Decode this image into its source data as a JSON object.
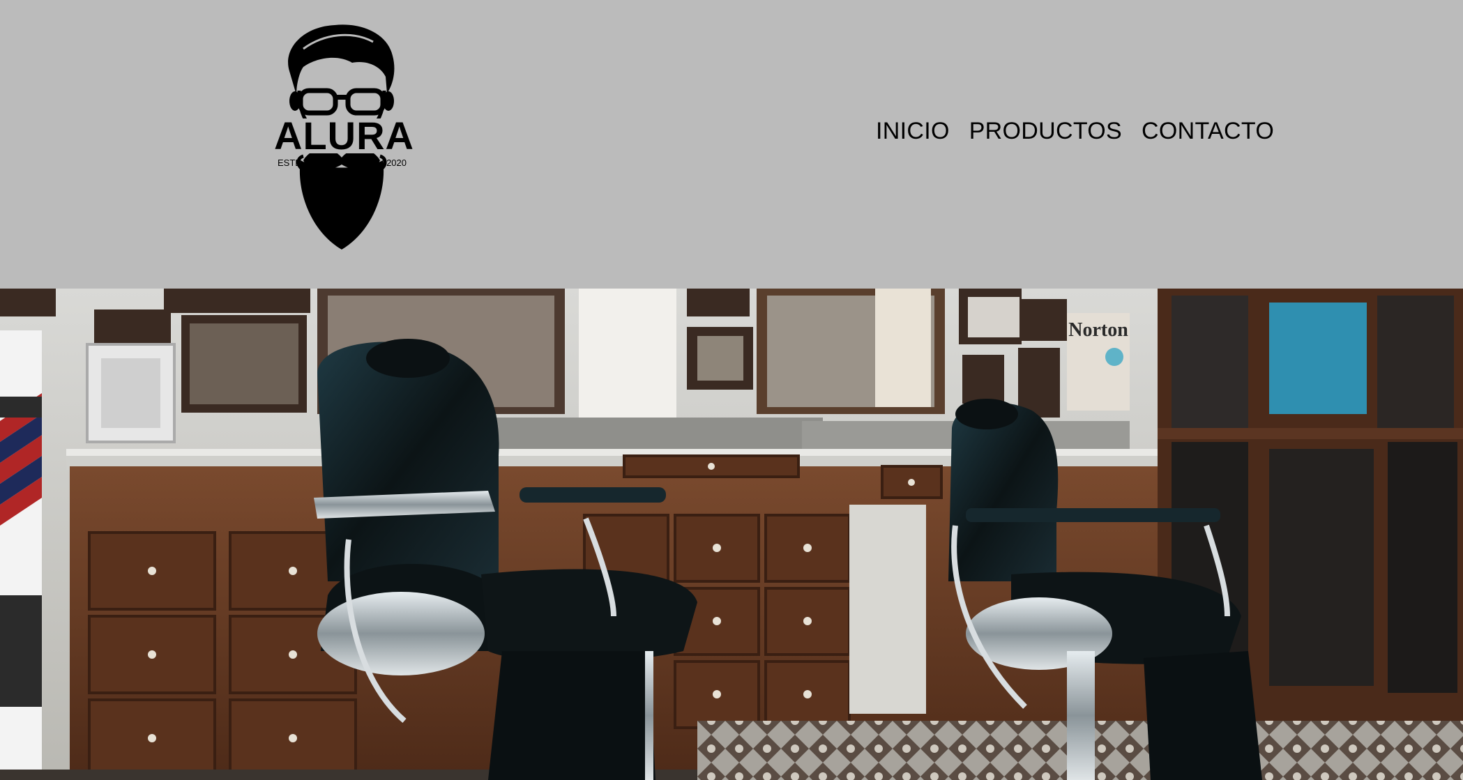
{
  "brand": {
    "name": "ALURA",
    "estd_label": "ESTD",
    "year": "2020",
    "logo_icon": "bearded-man-logo"
  },
  "nav": {
    "items": [
      {
        "label": "INICIO"
      },
      {
        "label": "PRODUCTOS"
      },
      {
        "label": "CONTACTO"
      }
    ]
  },
  "banner": {
    "image": "barbershop-interior-photo",
    "sign_text": "Norton"
  },
  "colors": {
    "header_bg": "#bbbbbb",
    "nav_text": "#000000",
    "wood": "#6b3d24",
    "chair_leather": "#10181c"
  }
}
